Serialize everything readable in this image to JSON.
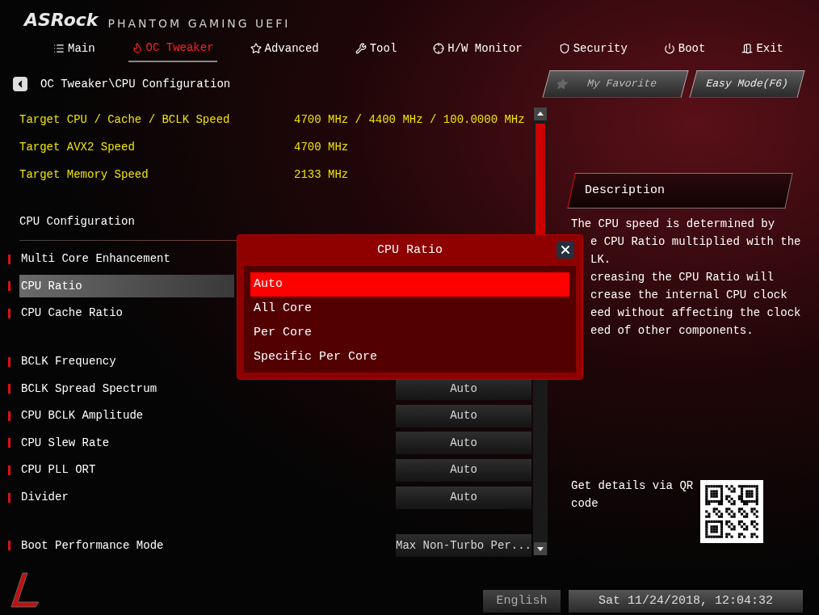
{
  "brand": {
    "logo": "ASRock",
    "subtitle": "PHANTOM GAMING UEFI"
  },
  "tabs": [
    {
      "label": "Main",
      "selected": false
    },
    {
      "label": "OC Tweaker",
      "selected": true
    },
    {
      "label": "Advanced",
      "selected": false
    },
    {
      "label": "Tool",
      "selected": false
    },
    {
      "label": "H/W Monitor",
      "selected": false
    },
    {
      "label": "Security",
      "selected": false
    },
    {
      "label": "Boot",
      "selected": false
    },
    {
      "label": "Exit",
      "selected": false
    }
  ],
  "breadcrumb": "OC Tweaker\\CPU Configuration",
  "top_buttons": [
    {
      "label": "My Favorite",
      "kind": "favorite"
    },
    {
      "label": "Easy Mode(F6)",
      "kind": "plain"
    }
  ],
  "info_rows": [
    {
      "label": "Target CPU / Cache / BCLK Speed",
      "value": "4700 MHz / 4400 MHz / 100.0000 MHz"
    },
    {
      "label": "Target AVX2 Speed",
      "value": "4700 MHz"
    },
    {
      "label": "Target Memory Speed",
      "value": "2133 MHz"
    }
  ],
  "section_title": "CPU Configuration",
  "setting_groups": [
    [
      {
        "label": "Multi Core Enhancement",
        "selected": false
      },
      {
        "label": "CPU Ratio",
        "selected": true
      },
      {
        "label": "CPU Cache Ratio",
        "selected": false
      }
    ],
    [
      {
        "label": "BCLK Frequency",
        "selected": false
      },
      {
        "label": "BCLK Spread Spectrum",
        "value": "Auto",
        "selected": false
      },
      {
        "label": "CPU BCLK Amplitude",
        "value": "Auto",
        "selected": false
      },
      {
        "label": "CPU Slew Rate",
        "value": "Auto",
        "selected": false
      },
      {
        "label": "CPU PLL ORT",
        "value": "Auto",
        "selected": false
      },
      {
        "label": "Divider",
        "value": "Auto",
        "selected": false
      }
    ],
    [
      {
        "label": "Boot Performance Mode",
        "value": "Max Non-Turbo Per...",
        "selected": false
      }
    ]
  ],
  "dialog": {
    "title": "CPU Ratio",
    "options": [
      {
        "label": "Auto",
        "selected": true
      },
      {
        "label": "All Core",
        "selected": false
      },
      {
        "label": "Per Core",
        "selected": false
      },
      {
        "label": "Specific Per Core",
        "selected": false
      }
    ]
  },
  "description": {
    "title": "Description",
    "lines": [
      "The CPU speed is determined by",
      "e CPU Ratio multiplied with the",
      "LK.",
      "creasing the CPU Ratio will",
      "crease the internal CPU clock",
      "eed without affecting the clock",
      "eed of other components."
    ]
  },
  "qr": {
    "text": "Get details via QR code"
  },
  "footer": {
    "language": "English",
    "datetime": "Sat 11/24/2018, 12:04:32"
  }
}
